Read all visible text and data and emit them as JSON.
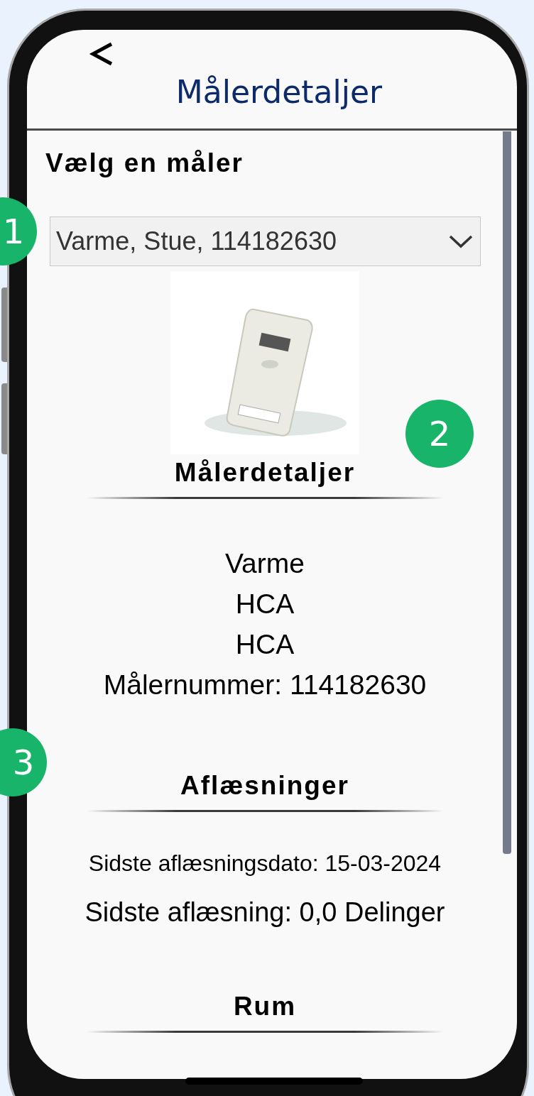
{
  "header": {
    "title": "Målerdetaljer"
  },
  "meter_select": {
    "label": "Vælg en måler",
    "value": "Varme, Stue, 114182630"
  },
  "details": {
    "heading": "Målerdetaljer",
    "lines": [
      "Varme",
      "HCA",
      "HCA",
      "Målernummer: 114182630"
    ]
  },
  "readings": {
    "heading": "Aflæsninger",
    "date": "Sidste aflæsningsdato: 15-03-2024",
    "reading": "Sidste aflæsning: 0,0 Delinger"
  },
  "rooms": {
    "heading": "Rum"
  },
  "callouts": [
    {
      "number": "1"
    },
    {
      "number": "2"
    },
    {
      "number": "3"
    }
  ]
}
